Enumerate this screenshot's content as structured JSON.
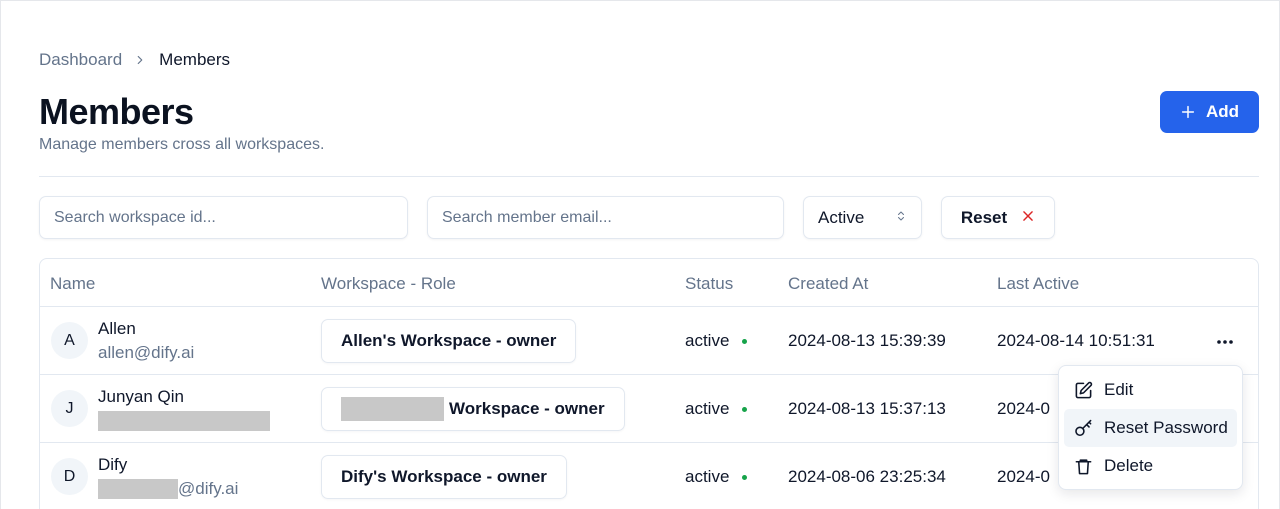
{
  "breadcrumb": {
    "parent": "Dashboard",
    "current": "Members"
  },
  "header": {
    "title": "Members",
    "subtitle": "Manage members cross all workspaces.",
    "add_label": "Add"
  },
  "filters": {
    "workspace_placeholder": "Search workspace id...",
    "email_placeholder": "Search member email...",
    "status_value": "Active",
    "reset_label": "Reset"
  },
  "table": {
    "columns": [
      "Name",
      "Workspace - Role",
      "Status",
      "Created At",
      "Last Active"
    ],
    "rows": [
      {
        "initial": "A",
        "name": "Allen",
        "email": "allen@dify.ai",
        "workspace": "Allen's Workspace - owner",
        "status": "active",
        "created_at": "2024-08-13 15:39:39",
        "last_active": "2024-08-14 10:51:31"
      },
      {
        "initial": "J",
        "name": "Junyan Qin",
        "email": "",
        "workspace": "Workspace - owner",
        "status": "active",
        "created_at": "2024-08-13 15:37:13",
        "last_active": "2024-0"
      },
      {
        "initial": "D",
        "name": "Dify",
        "email": "@dify.ai",
        "workspace": "Dify's Workspace - owner",
        "status": "active",
        "created_at": "2024-08-06 23:25:34",
        "last_active": "2024-0"
      }
    ]
  },
  "menu": {
    "items": [
      "Edit",
      "Reset Password",
      "Delete"
    ]
  },
  "colors": {
    "primary": "#2563eb",
    "status_active": "#16a34a",
    "reset_x": "#dc2626",
    "muted": "#64748b"
  },
  "icons": [
    "chevron-right-icon",
    "plus-icon",
    "chevron-up-down-icon",
    "x-icon",
    "more-horizontal-icon",
    "edit-icon",
    "key-icon",
    "trash-icon"
  ]
}
